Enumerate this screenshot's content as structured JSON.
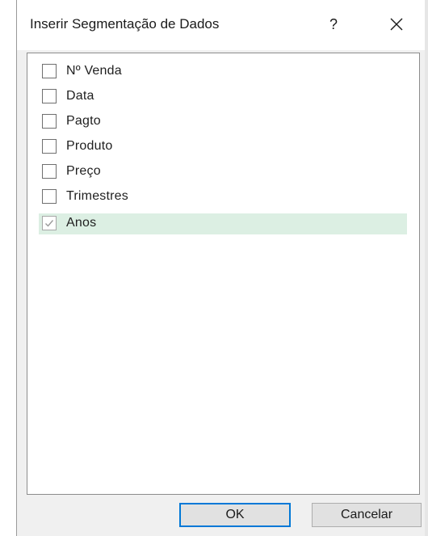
{
  "dialog": {
    "title": "Inserir Segmentação de Dados",
    "help_label": "?",
    "fields": [
      {
        "label": "Nº Venda",
        "checked": false
      },
      {
        "label": "Data",
        "checked": false
      },
      {
        "label": "Pagto",
        "checked": false
      },
      {
        "label": "Produto",
        "checked": false
      },
      {
        "label": "Preço",
        "checked": false
      },
      {
        "label": "Trimestres",
        "checked": false
      },
      {
        "label": "Anos",
        "checked": true
      }
    ],
    "ok_label": "OK",
    "cancel_label": "Cancelar"
  },
  "colors": {
    "selected_row": "#dcefe3",
    "default_button_border": "#0078d7",
    "dialog_background": "#f0f0f0"
  },
  "icons": {
    "help": "question-mark-icon",
    "close": "close-icon",
    "check": "checkmark-icon"
  }
}
